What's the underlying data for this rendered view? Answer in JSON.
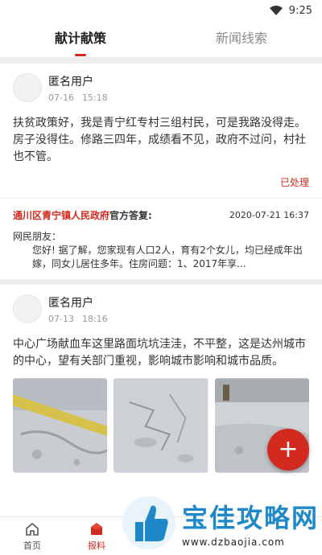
{
  "status_bar": {
    "time": "9:25"
  },
  "tabs": [
    {
      "label": "献计献策",
      "active": true
    },
    {
      "label": "新闻线索",
      "active": false
    }
  ],
  "posts": [
    {
      "user": "匿名用户",
      "date": "07-16",
      "time": "15:18",
      "content": "扶贫政策好，我是青宁红专村三组村民，可是我路没得走。房子没得住。修路三四年，成绩看不见，政府不过问，村社也不管。",
      "status": "已处理",
      "reply": {
        "org": "通川区青宁镇人民政府",
        "tag": "官方答复:",
        "datetime": "2020-07-21 16:37",
        "greeting": "网民朋友：",
        "body": "您好! 据了解，您家现有人口2人，育有2个女儿，均已经成年出嫁，同女儿居住多年。住房问题：1、2017年享..."
      }
    },
    {
      "user": "匿名用户",
      "date": "07-13",
      "time": "18:16",
      "content": "中心广场献血车这里路面坑坑洼洼，不平整，这是达州城市的中心，望有关部门重视，影响城市影响和城市品质。"
    }
  ],
  "fab": {
    "icon": "plus-icon",
    "label": "+"
  },
  "bottom_nav": [
    {
      "label": "首页",
      "icon": "home-icon",
      "active": false
    },
    {
      "label": "报料",
      "icon": "report-icon",
      "active": true
    }
  ],
  "watermark": {
    "title": "宝佳攻略网",
    "url": "www.dzbaojia.com"
  },
  "colors": {
    "accent": "#d32a1f",
    "watermark": "#1e88c8"
  }
}
